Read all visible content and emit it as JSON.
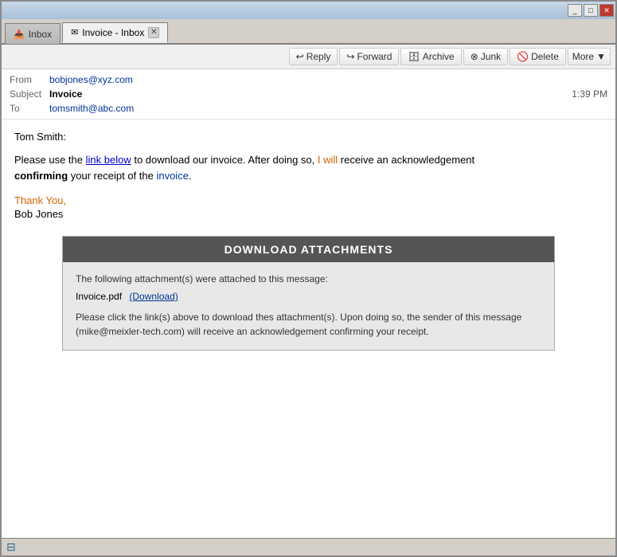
{
  "window": {
    "title_bar_buttons": {
      "minimize": "_",
      "maximize": "□",
      "close": "✕"
    }
  },
  "tabs": [
    {
      "id": "inbox",
      "icon": "📥",
      "label": "Inbox",
      "active": false
    },
    {
      "id": "invoice-inbox",
      "icon": "✉",
      "label": "Invoice - Inbox",
      "active": true,
      "closeable": true
    }
  ],
  "toolbar": {
    "reply_label": "Reply",
    "forward_label": "Forward",
    "archive_label": "Archive",
    "junk_label": "Junk",
    "delete_label": "Delete",
    "more_label": "More"
  },
  "email": {
    "from_label": "From",
    "from_value": "bobjones@xyz.com",
    "subject_label": "Subject",
    "subject_value": "Invoice",
    "to_label": "To",
    "to_value": "tomsmith@abc.com",
    "time": "1:39 PM"
  },
  "body": {
    "greeting": "Tom Smith:",
    "paragraph1_plain1": "Please use the ",
    "paragraph1_link": "link below",
    "paragraph1_plain2": " to download our invoice.  After doing so, ",
    "paragraph1_orange1": "I will",
    "paragraph1_plain3": " receive an acknowledgement",
    "paragraph1_bold1": "confirming",
    "paragraph1_plain4": " your receipt of the ",
    "paragraph1_blue1": "invoice",
    "paragraph1_plain5": ".",
    "thank_you": "Thank You,",
    "signature": "Bob Jones"
  },
  "download_box": {
    "header": "DOWNLOAD ATTACHMENTS",
    "intro": "The following attachment(s) were attached to this message:",
    "filename": "Invoice.pdf",
    "download_link": "(Download)",
    "notice": "Please click the link(s) above to download thes attachment(s). Upon doing so, the sender of this message (mike@meixler-tech.com) will receive an acknowledgement confirming your receipt."
  },
  "status_bar": {
    "icon": "monitor"
  }
}
